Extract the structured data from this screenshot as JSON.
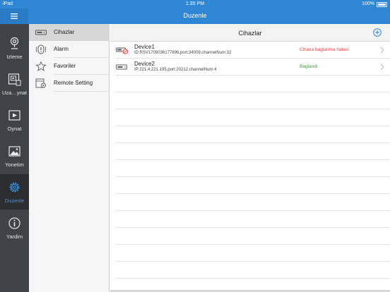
{
  "status_bar": {
    "carrier": "iPad",
    "time": "1:35 PM",
    "battery": "100%"
  },
  "header": {
    "title": "Duzenle",
    "menu_icon": "hamburger-icon"
  },
  "tabs": [
    {
      "label": "Izleme",
      "icon": "camera-icon",
      "active": false
    },
    {
      "label": "Uza…ynat",
      "icon": "remote-playback-icon",
      "active": false
    },
    {
      "label": "Oynat",
      "icon": "playback-icon",
      "active": false
    },
    {
      "label": "Yonetim",
      "icon": "image-icon",
      "active": false
    },
    {
      "label": "Duzenle",
      "icon": "gear-icon",
      "active": true
    },
    {
      "label": "Yardim",
      "icon": "info-icon",
      "active": false
    }
  ],
  "submenu": [
    {
      "label": "Cihazlar",
      "icon": "device-icon",
      "active": true
    },
    {
      "label": "Alarm",
      "icon": "alarm-icon",
      "active": false
    },
    {
      "label": "Favoriler",
      "icon": "star-icon",
      "active": false
    },
    {
      "label": "Remote Setting",
      "icon": "remote-setting-icon",
      "active": false
    }
  ],
  "main": {
    "title": "Cihazlar",
    "add_icon": "plus-circle-icon",
    "devices": [
      {
        "name": "Device1",
        "info": "ID:RSV1709036177896,port:34009,channelNum:32",
        "status": "Cihaza baglanma hatasi",
        "status_color": "#e8403a"
      },
      {
        "name": "Device2",
        "info": "IP:221.4.221.195,port:20212,channelNum:4",
        "status": "Baglandi",
        "status_color": "#3e9a3e"
      }
    ]
  },
  "colors": {
    "accent": "#2f86d4",
    "active_tab": "#3f97e8",
    "tabbar": "#3f4246"
  }
}
